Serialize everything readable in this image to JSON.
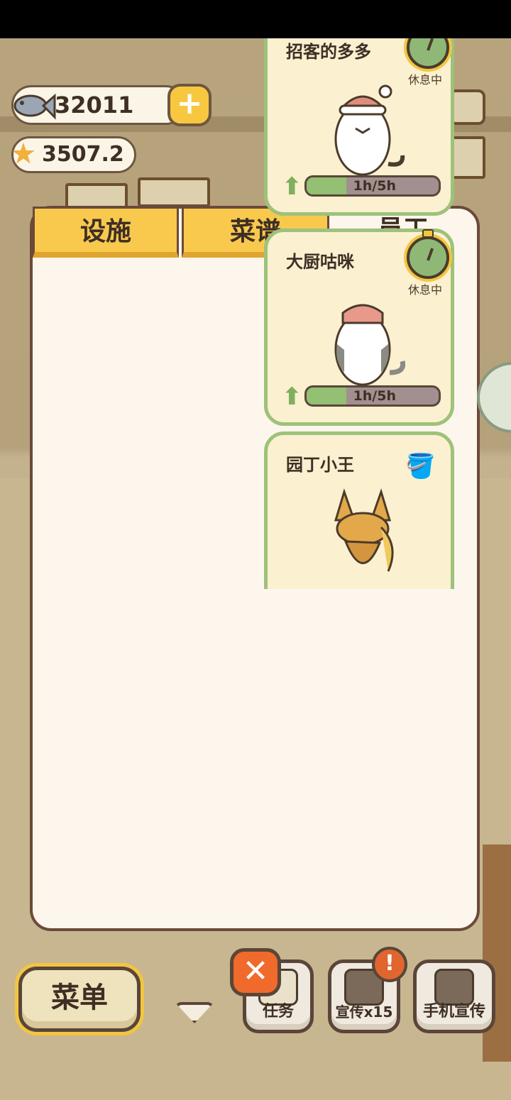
{
  "currency": {
    "fish": "32011",
    "stars": "3507.2",
    "add_label": "+"
  },
  "tabs": [
    {
      "label": "设施"
    },
    {
      "label": "菜谱"
    },
    {
      "label": "员工"
    }
  ],
  "staff": [
    {
      "name": "招客的多多",
      "status": "休息中",
      "progress": "1h/5h",
      "progress_fraction": 0.2,
      "icon": "timer-icon"
    },
    {
      "name": "大厨咕咪",
      "status": "休息中",
      "progress": "1h/5h",
      "progress_fraction": 0.2,
      "icon": "timer-icon"
    },
    {
      "name": "园丁小王",
      "status": "",
      "progress": "",
      "icon": "watering-can-icon"
    }
  ],
  "bottom": {
    "menu_label": "菜单",
    "tasks_label": "任务",
    "promote_label": "宣传x15",
    "phone_promote_label": "手机宣传",
    "close_label": "✕",
    "alert_label": "!"
  },
  "colors": {
    "accent_yellow": "#f9c94e",
    "card_border_green": "#9dc27b",
    "progress_green": "#93c072",
    "close_orange": "#f06a2c"
  }
}
